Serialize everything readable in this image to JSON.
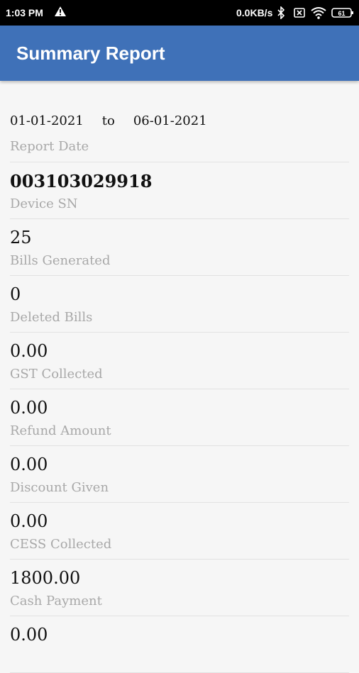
{
  "status_bar": {
    "time": "1:03 PM",
    "net_speed": "0.0KB/s",
    "battery": "61"
  },
  "app_bar": {
    "title": "Summary Report"
  },
  "report_date": {
    "from": "01-01-2021",
    "to_word": "to",
    "to": "06-01-2021",
    "label": "Report Date"
  },
  "rows": [
    {
      "value": "003103029918",
      "label": "Device SN"
    },
    {
      "value": "25",
      "label": "Bills Generated"
    },
    {
      "value": "0",
      "label": "Deleted Bills"
    },
    {
      "value": "0.00",
      "label": "GST Collected"
    },
    {
      "value": "0.00",
      "label": "Refund Amount"
    },
    {
      "value": "0.00",
      "label": "Discount Given"
    },
    {
      "value": "0.00",
      "label": "CESS Collected"
    },
    {
      "value": "1800.00",
      "label": "Cash Payment"
    },
    {
      "value": "0.00",
      "label": ""
    }
  ]
}
